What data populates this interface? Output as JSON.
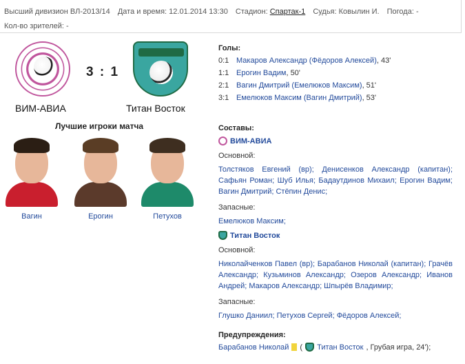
{
  "info": {
    "division": "Высший дивизион ВЛ-2013/14",
    "datetime_label": "Дата и время:",
    "datetime": "12.01.2014 13:30",
    "stadium_label": "Стадион:",
    "stadium": "Спартак-1",
    "referee_label": "Судья:",
    "referee": "Ковылин И.",
    "weather_label": "Погода:",
    "weather": "-",
    "spectators_label": "Кол-во зрителей:",
    "spectators": "-"
  },
  "match": {
    "score": "3 : 1",
    "home_team": "ВИМ-АВИА",
    "away_team": "Титан Восток"
  },
  "best_players": {
    "title": "Лучшие игроки матча",
    "players": [
      {
        "name": "Вагин",
        "shirt_color": "#c91f2e",
        "hair_color": "#2b1e14"
      },
      {
        "name": "Ерогин",
        "shirt_color": "#5b3a2b",
        "hair_color": "#5a3d25"
      },
      {
        "name": "Петухов",
        "shirt_color": "#1e8a6a",
        "hair_color": "#3e2e20"
      }
    ]
  },
  "goals": {
    "title": "Голы:",
    "items": [
      {
        "score": "0:1",
        "text": "Макаров Александр (Фёдоров Алексей)",
        "minute": ", 43'"
      },
      {
        "score": "1:1",
        "text": "Ерогин Вадим",
        "minute": ", 50'"
      },
      {
        "score": "2:1",
        "text": "Вагин Дмитрий (Емелюков Максим)",
        "minute": ", 51'"
      },
      {
        "score": "3:1",
        "text": "Емелюков Максим (Вагин Дмитрий)",
        "minute": ", 53'"
      }
    ]
  },
  "lineups": {
    "title": "Составы:",
    "main_label": "Основной:",
    "subs_label": "Запасные:",
    "home": {
      "team": "ВИМ-АВИА",
      "main": "Толстяков Евгений (вр); Денисенков Александр (капитан); Сафьян Роман; Шуб Илья; Бадаутдинов Михаил; Ерогин Вадим; Вагин Дмитрий; Стёпин Денис;",
      "subs": "Емелюков Максим;"
    },
    "away": {
      "team": "Титан Восток",
      "main": "Николайченков Павел (вр); Барабанов Николай (капитан); Грачёв Александр; Кузьминов Александр; Озеров Александр; Иванов Андрей; Макаров Александр; Шпырёв Владимир;",
      "subs": "Глушко Даниил; Петухов Сергей; Фёдоров Алексей;"
    }
  },
  "warnings": {
    "title": "Предупреждения:",
    "player": "Барабанов Николай",
    "open_paren": "(",
    "team": "Титан Восток",
    "detail": ", Грубая игра, 24');"
  },
  "colors": {
    "link": "#224a9b",
    "home_brand": "#c0569d",
    "away_brand": "#3aa6a0",
    "yellow_card": "#f1d43c"
  }
}
